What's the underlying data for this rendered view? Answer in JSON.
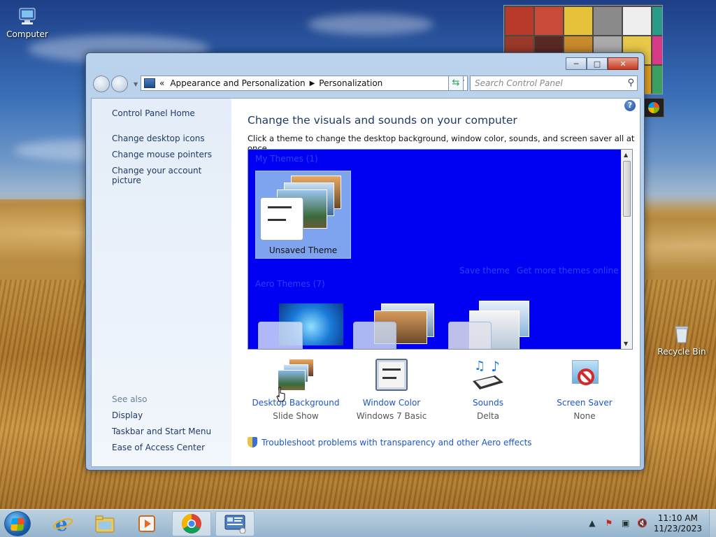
{
  "desktop": {
    "icons": [
      {
        "label": "Computer"
      },
      {
        "label": "Recycle Bin"
      }
    ]
  },
  "window": {
    "address": {
      "prefix": "«",
      "crumbs": [
        "Appearance and Personalization",
        "Personalization"
      ]
    },
    "search_placeholder": "Search Control Panel",
    "left_pane": {
      "home": "Control Panel Home",
      "links": [
        "Change desktop icons",
        "Change mouse pointers",
        "Change your account picture"
      ],
      "see_also": "See also",
      "see_also_links": [
        "Display",
        "Taskbar and Start Menu",
        "Ease of Access Center"
      ]
    },
    "main": {
      "title": "Change the visuals and sounds on your computer",
      "description": "Click a theme to change the desktop background, window color, sounds, and screen saver all at once.",
      "my_themes_header": "My Themes (1)",
      "selected_theme": "Unsaved Theme",
      "save_theme": "Save theme",
      "get_more": "Get more themes online",
      "aero_header": "Aero Themes (7)",
      "options": [
        {
          "title": "Desktop Background",
          "value": "Slide Show"
        },
        {
          "title": "Window Color",
          "value": "Windows 7 Basic"
        },
        {
          "title": "Sounds",
          "value": "Delta"
        },
        {
          "title": "Screen Saver",
          "value": "None"
        }
      ],
      "troubleshoot": "Troubleshoot problems with transparency and other Aero effects"
    }
  },
  "taskbar": {
    "time": "11:10 AM",
    "date": "11/23/2023"
  },
  "colors": {
    "theme_area_bg": "#0000f2",
    "link": "#1b56c7",
    "heading": "#1e3a66"
  }
}
